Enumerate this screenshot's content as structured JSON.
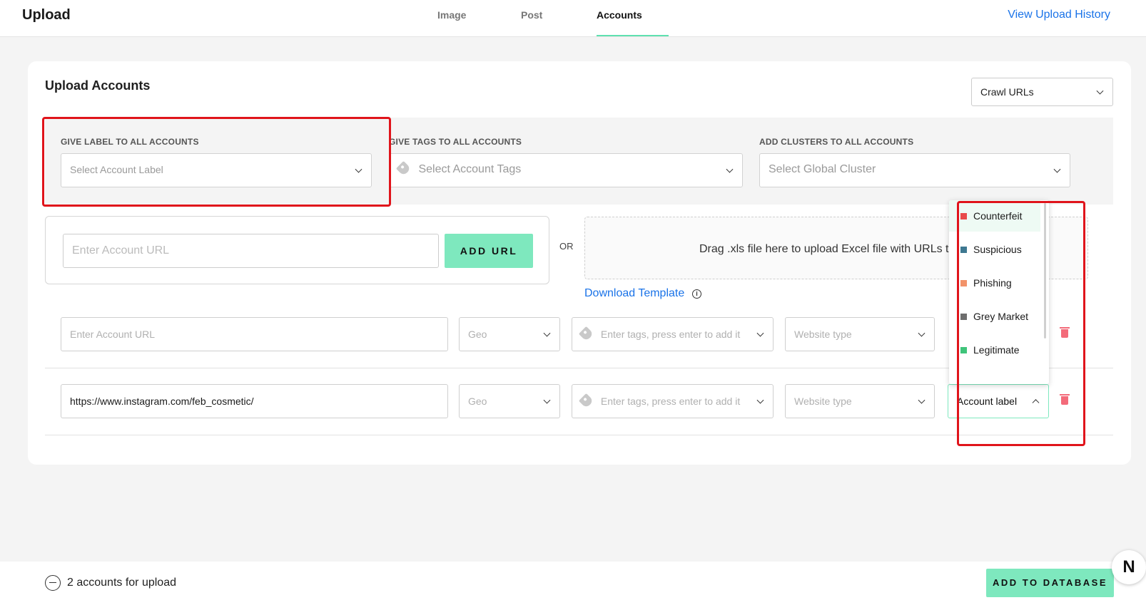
{
  "header": {
    "title": "Upload",
    "tabs": [
      {
        "label": "Image",
        "active": false
      },
      {
        "label": "Post",
        "active": false
      },
      {
        "label": "Accounts",
        "active": true
      }
    ],
    "history_link": "View Upload History"
  },
  "card": {
    "title": "Upload Accounts",
    "crawl_select": "Crawl URLs"
  },
  "global": {
    "label_heading": "GIVE LABEL TO ALL ACCOUNTS",
    "label_placeholder": "Select Account Label",
    "tags_heading": "GIVE TAGS TO ALL ACCOUNTS",
    "tags_placeholder": "Select Account Tags",
    "clusters_heading": "ADD CLUSTERS TO ALL ACCOUNTS",
    "clusters_placeholder": "Select Global Cluster"
  },
  "url_entry": {
    "placeholder": "Enter Account URL",
    "add_button": "ADD URL",
    "or": "OR",
    "drop_text": "Drag .xls file here to upload Excel file with URLs to c",
    "download_link": "Download Template"
  },
  "rows": [
    {
      "url": "",
      "url_placeholder": "Enter Account URL",
      "geo": "Geo",
      "tags": "Enter tags, press enter to add it",
      "website_type": "Website type"
    },
    {
      "url": "https://www.instagram.com/feb_cosmetic/",
      "url_placeholder": "Enter Account URL",
      "geo": "Geo",
      "tags": "Enter tags, press enter to add it",
      "website_type": "Website type",
      "account_label": "Account label"
    }
  ],
  "label_dropdown": {
    "options": [
      {
        "label": "Counterfeit",
        "color": "#e84a4a"
      },
      {
        "label": "Suspicious",
        "color": "#3e7891"
      },
      {
        "label": "Phishing",
        "color": "#f2936a"
      },
      {
        "label": "Grey Market",
        "color": "#6e6e6e"
      },
      {
        "label": "Legitimate",
        "color": "#3fc47a"
      }
    ]
  },
  "footer": {
    "count_text": "2 accounts for upload",
    "db_button": "ADD TO DATABASE"
  },
  "badge": "N"
}
